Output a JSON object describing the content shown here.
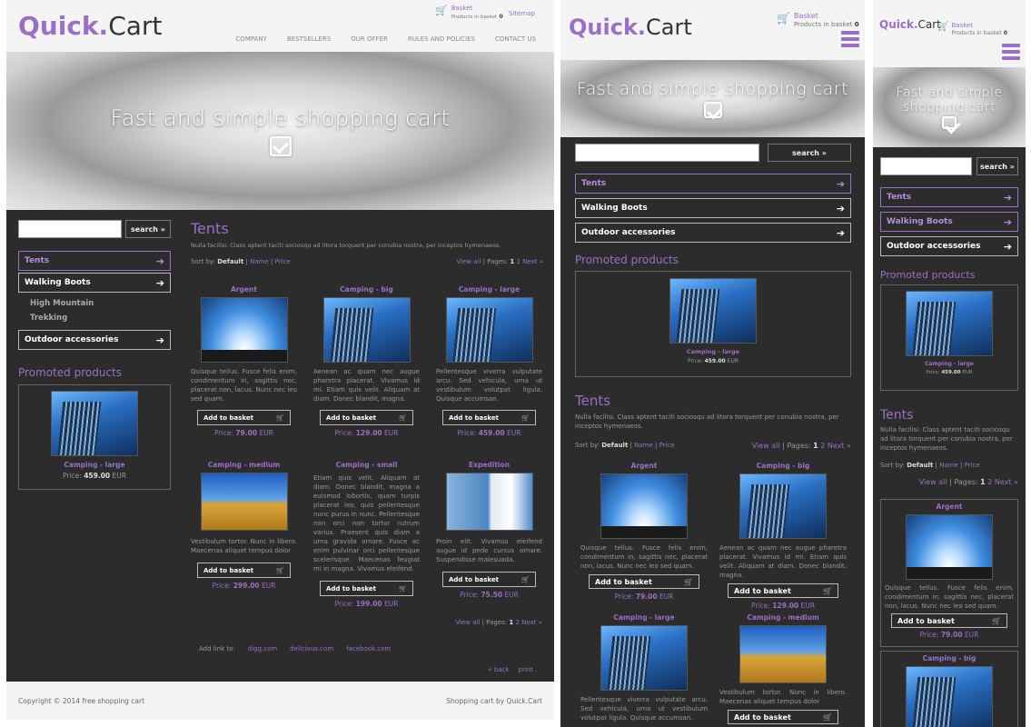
{
  "brand": {
    "first": "Quick.",
    "second": "Cart"
  },
  "basket": {
    "label": "Basket",
    "count_label": "Products in basket",
    "count": "0",
    "sitemap": "Sitemap"
  },
  "nav": [
    "COMPANY",
    "BESTSELLERS",
    "OUR OFFER",
    "RULES AND POLICIES",
    "CONTACT US"
  ],
  "hero": {
    "title": "Fast and simple shopping cart"
  },
  "search": {
    "button": "search »",
    "placeholder": ""
  },
  "categories": [
    {
      "label": "Tents",
      "active": true
    },
    {
      "label": "Walking Boots",
      "active": false
    },
    {
      "label": "Outdoor accessories",
      "active": false
    }
  ],
  "subcategories": [
    "High Mountain",
    "Trekking"
  ],
  "promoted": {
    "heading": "Promoted products",
    "product": {
      "name": "Camping - large",
      "price_label": "Price:",
      "price": "459.00",
      "currency": "EUR"
    }
  },
  "category_page": {
    "title": "Tents",
    "description": "Nulla facilisi. Class aptent taciti sociosqu ad litora torquent per conubia nostra, per inceptos hymenaeos.",
    "sort_by": "Sort by:",
    "sort_default": "Default",
    "sort_name": "Name",
    "sort_price": "Price",
    "view_all": "View all",
    "pages_label": "Pages:",
    "page_current": "1",
    "page_2": "2",
    "next": "Next »"
  },
  "products": [
    {
      "name": "Argent",
      "image": "sky-sunrise",
      "desc": "Quisque tellus. Fusce felis enim, condimentum in, sagittis nec, placerat non, lacus. Nunc nec leo sed quam.",
      "price": "79.00"
    },
    {
      "name": "Camping - big",
      "image": "building-up",
      "desc": "Aenean ac quam nec augue pharetra placerat. Vivamus id mi. Etiam quis velit. Aliquam at diam. Donec blandit, magna.",
      "price": "129.00"
    },
    {
      "name": "Camping - large",
      "image": "building",
      "desc": "Pellentesque viverra vulputate arcu. Sed vehicula, urna ut vestibulum volutpat ligula. Quisque accumsan.",
      "price": "459.00"
    },
    {
      "name": "Camping - medium",
      "image": "field",
      "desc": "Vestibulum tortor. Nunc in libero. Maecenas aliquet tempus dolor",
      "price": "299.00"
    },
    {
      "name": "Camping - small",
      "image": "none",
      "desc": "Etiam quis velit. Aliquam at diam. Donec blandit, magna a euismod lobortis, quam turpis placerat leo, quis pellentesque nunc purus in nunc. Pellentesque non orci non tortor rutrum varius. Praesent quis diam a urna gravida ornare. Fusce ac enim pulvinar orci pellentesque scelerisque. Maecenas feugiat mi in magna. Vivamus eleifend.",
      "price": "199.00"
    },
    {
      "name": "Expedition",
      "image": "glass",
      "desc": "Proin elit. Vivamus eleifend augue id pede cursus ornare. Suspendisse malesuada.",
      "price": "75.50"
    }
  ],
  "add_to_basket": "Add to basket",
  "price_label": "Price:",
  "currency": "EUR",
  "addlink": {
    "label": "Add link to:",
    "links": [
      "digg.com",
      "delicious.com",
      "facebook.com"
    ]
  },
  "bottom_links": {
    "back": "« back",
    "print": "print"
  },
  "footer": {
    "copyright": "Copyright © 2014 free shopping cart",
    "credit": "Shopping cart by Quick.Cart"
  },
  "colors": {
    "accent": "#9b6fc6",
    "panel": "#2c2c2c",
    "bar": "#f4f4f4"
  }
}
